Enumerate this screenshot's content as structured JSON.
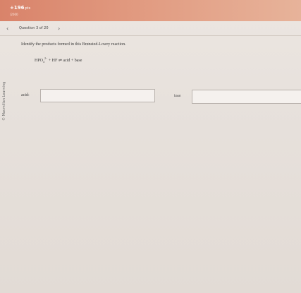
{
  "header": {
    "score": "+196",
    "score_unit": "pts",
    "score_sub": "/2000"
  },
  "question_nav": {
    "prev_icon": "chevron-left",
    "next_icon": "chevron-right",
    "label": "Question 3 of 20"
  },
  "sidebar": {
    "copyright": "© Macmillan Learning"
  },
  "question": {
    "prompt": "Identify the products formed in this Brønsted-Lowry reaction.",
    "equation": {
      "reactant1": "HPO",
      "reactant1_sub": "4",
      "reactant1_sup": "2−",
      "plus1": "+",
      "reactant2": "HF",
      "arrow": "⇌",
      "product1": "acid",
      "plus2": "+",
      "product2": "base"
    }
  },
  "answers": {
    "acid_label": "acid:",
    "acid_value": "",
    "base_label": "base:",
    "base_value": ""
  }
}
